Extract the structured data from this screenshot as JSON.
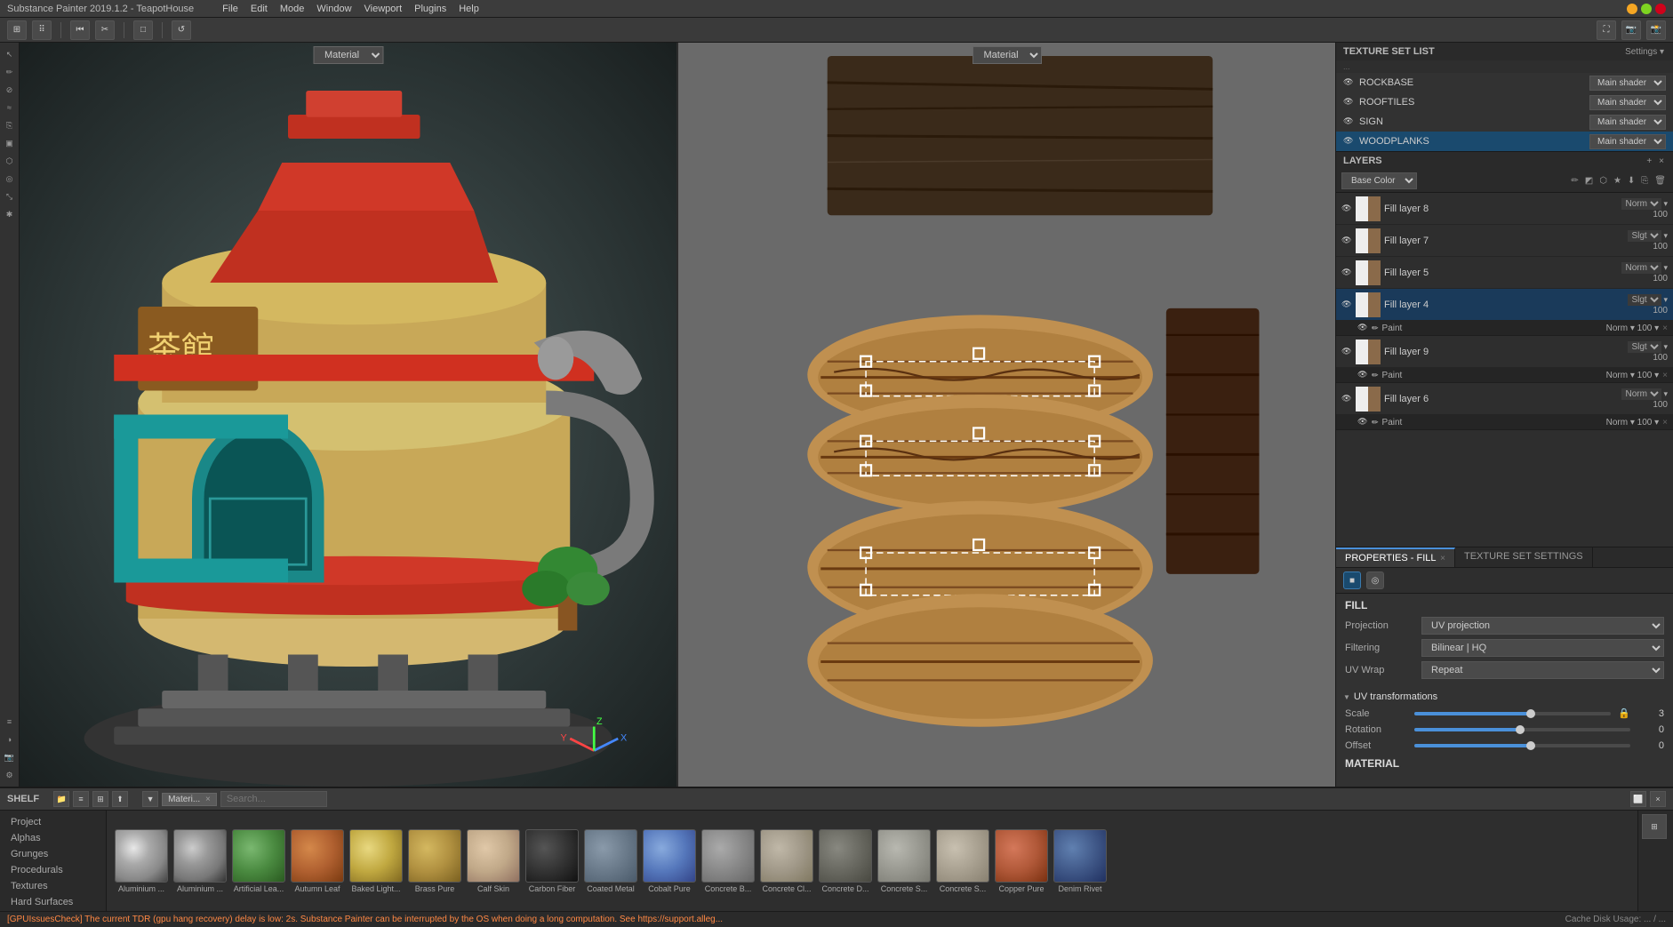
{
  "window": {
    "title": "Substance Painter 2019.1.2 - TeapotHouse"
  },
  "menu": {
    "items": [
      "File",
      "Edit",
      "Mode",
      "Window",
      "Viewport",
      "Plugins",
      "Help"
    ]
  },
  "toolbar": {
    "buttons": [
      "grid",
      "dots",
      "skip-back",
      "cut",
      "square",
      "refresh"
    ]
  },
  "viewport_left": {
    "dropdown": "Material"
  },
  "viewport_right": {
    "dropdown": "Material"
  },
  "texture_set_list": {
    "title": "TEXTURE SET LIST",
    "settings_btn": "Settings ▾",
    "items": [
      {
        "name": "ROCKBASE",
        "shader": "Main shader",
        "visible": true
      },
      {
        "name": "ROOFTILES",
        "shader": "Main shader",
        "visible": true
      },
      {
        "name": "SIGN",
        "shader": "Main shader",
        "visible": true
      },
      {
        "name": "WOODPLANKS",
        "shader": "Main shader",
        "visible": true,
        "active": true
      }
    ]
  },
  "layers": {
    "title": "LAYERS",
    "close_btn": "×",
    "base_color": "Base Color",
    "items": [
      {
        "name": "Fill layer 8",
        "blend": "Norm",
        "value": "100",
        "visible": true,
        "thumb_left": "white",
        "thumb_right": "wood"
      },
      {
        "name": "Fill layer 7",
        "blend": "Slgt",
        "value": "100",
        "visible": true,
        "thumb_left": "white",
        "thumb_right": "wood",
        "paint_sub": null
      },
      {
        "name": "Fill layer 5",
        "blend": "Norm",
        "value": "100",
        "visible": true,
        "thumb_left": "white",
        "thumb_right": "wood"
      },
      {
        "name": "Fill layer 4",
        "blend": "Slgt",
        "value": "100",
        "visible": true,
        "thumb_left": "white",
        "thumb_right": "wood",
        "has_paint": true,
        "paint_blend": "Norm",
        "paint_value": "100"
      },
      {
        "name": "Fill layer 9",
        "blend": "Slgt",
        "value": "100",
        "visible": true,
        "thumb_left": "white",
        "thumb_right": "wood",
        "has_paint": true,
        "paint_blend": "Norm",
        "paint_value": "100"
      },
      {
        "name": "Fill layer 6",
        "blend": "Norm",
        "value": "100",
        "visible": true,
        "thumb_left": "white",
        "thumb_right": "wood",
        "has_paint": true,
        "paint_blend": "Norm",
        "paint_value": "100"
      }
    ]
  },
  "properties": {
    "tabs": [
      {
        "label": "PROPERTIES - FILL",
        "active": true,
        "closeable": true
      },
      {
        "label": "TEXTURE SET SETTINGS",
        "active": false,
        "closeable": false
      }
    ],
    "fill": {
      "title": "FILL",
      "projection": {
        "label": "Projection",
        "value": "UV projection"
      },
      "filtering": {
        "label": "Filtering",
        "value": "Bilinear | HQ"
      },
      "uv_wrap": {
        "label": "UV Wrap",
        "value": "Repeat"
      },
      "uv_transformations": {
        "title": "UV transformations",
        "scale": {
          "label": "Scale",
          "value": "3",
          "fill_pct": 60
        },
        "rotation": {
          "label": "Rotation",
          "value": "0",
          "fill_pct": 50
        },
        "offset": {
          "label": "Offset",
          "value": "0",
          "fill_pct": 55
        }
      },
      "material": {
        "title": "MATERIAL"
      }
    }
  },
  "shelf": {
    "title": "SHELF",
    "nav_items": [
      {
        "label": "Project",
        "active": false
      },
      {
        "label": "Alphas",
        "active": false
      },
      {
        "label": "Grunges",
        "active": false
      },
      {
        "label": "Procedurals",
        "active": false
      },
      {
        "label": "Textures",
        "active": false
      },
      {
        "label": "Hard Surfaces",
        "active": false
      }
    ],
    "filter_tag": "Materi...",
    "search_placeholder": "Search...",
    "items": [
      {
        "label": "Aluminium ...",
        "class": "mat-aluminium-light"
      },
      {
        "label": "Aluminium ...",
        "class": "mat-aluminium"
      },
      {
        "label": "Artificial Lea...",
        "class": "mat-artificial-leaf"
      },
      {
        "label": "Autumn Leaf",
        "class": "mat-autumn-leaf"
      },
      {
        "label": "Baked Light...",
        "class": "mat-baked-light"
      },
      {
        "label": "Brass Pure",
        "class": "mat-brass"
      },
      {
        "label": "Calf Skin",
        "class": "mat-calf-skin"
      },
      {
        "label": "Carbon Fiber",
        "class": "mat-carbon-fiber"
      },
      {
        "label": "Coated Metal",
        "class": "mat-coated-metal"
      },
      {
        "label": "Cobalt Pure",
        "class": "mat-cobalt"
      },
      {
        "label": "Concrete B...",
        "class": "mat-concrete-b"
      },
      {
        "label": "Concrete Cl...",
        "class": "mat-concrete-cl"
      },
      {
        "label": "Concrete D...",
        "class": "mat-concrete-d"
      },
      {
        "label": "Concrete S...",
        "class": "mat-concrete-s"
      },
      {
        "label": "Concrete S...",
        "class": "mat-concrete-s2"
      },
      {
        "label": "Copper Pure",
        "class": "mat-copper"
      },
      {
        "label": "Denim Rivet",
        "class": "mat-denim"
      }
    ]
  },
  "status_bar": {
    "warning": "[GPUIssuesCheck] The current TDR (gpu hang recovery) delay is low: 2s. Substance Painter can be interrupted by the OS when doing a long computation. See https://support.alleg...",
    "right": "Cache Disk Usage: ... / ..."
  }
}
